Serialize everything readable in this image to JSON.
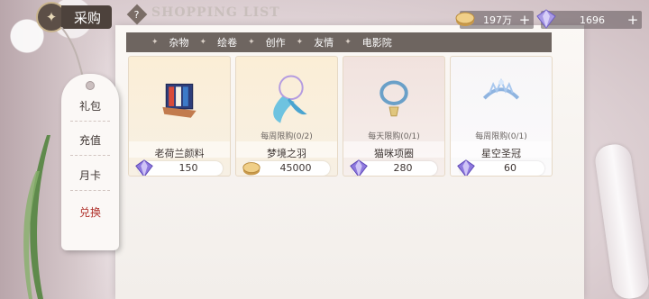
{
  "header": {
    "title": "采购",
    "help_label": "?",
    "subtitle": "SHOPPING LIST"
  },
  "currency": [
    {
      "icon": "gold-coin-icon",
      "value": "197万",
      "plus": "+"
    },
    {
      "icon": "diamond-icon",
      "value": "1696",
      "plus": "+"
    }
  ],
  "tabs": [
    {
      "label": "杂物"
    },
    {
      "label": "绘卷"
    },
    {
      "label": "创作"
    },
    {
      "label": "友情"
    },
    {
      "label": "电影院"
    }
  ],
  "sidebar": {
    "items": [
      {
        "label": "礼包"
      },
      {
        "label": "充值"
      },
      {
        "label": "月卡"
      },
      {
        "label": "兑换",
        "active": true
      }
    ]
  },
  "cards": [
    {
      "name": "老荷兰颜料",
      "limit": "",
      "price": "150",
      "price_icon": "diamond-icon",
      "art": "paint-box"
    },
    {
      "name": "梦境之羽",
      "limit": "每周限购(0/2)",
      "price": "45000",
      "price_icon": "gold-coin-icon",
      "art": "dream-feather"
    },
    {
      "name": "猫咪项圈",
      "limit": "每天限购(0/1)",
      "price": "280",
      "price_icon": "diamond-icon",
      "art": "cat-collar"
    },
    {
      "name": "星空圣冠",
      "limit": "每周限购(0/1)",
      "price": "60",
      "price_icon": "diamond-icon",
      "art": "tiara"
    }
  ],
  "colors": {
    "tab_bar": "#6e6560",
    "active_side": "#b0302a",
    "title_plate": "#4d423c"
  }
}
